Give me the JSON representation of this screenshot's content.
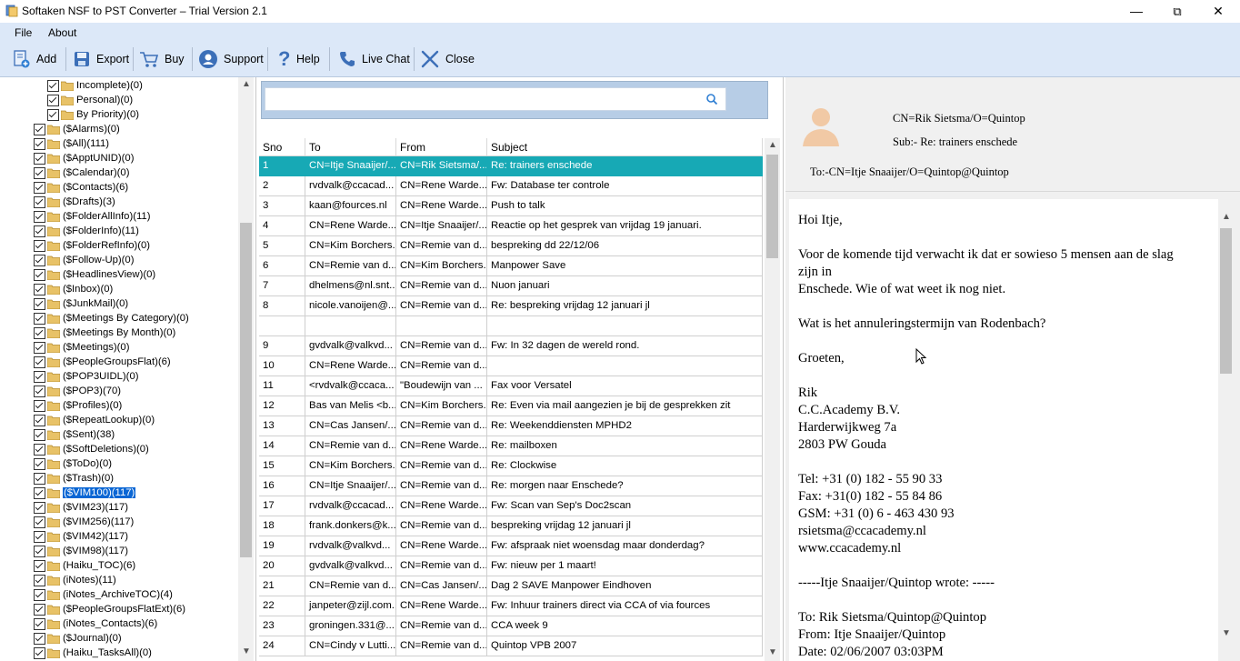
{
  "window": {
    "title": "Softaken NSF to PST Converter – Trial Version 2.1",
    "minimize": "—",
    "maximize": "⧉",
    "close": "✕"
  },
  "menu": [
    "File",
    "About"
  ],
  "toolbar": {
    "add": "Add",
    "export": "Export",
    "buy": "Buy",
    "support": "Support",
    "help": "Help",
    "live_chat": "Live Chat",
    "close": "Close"
  },
  "tree": {
    "items": [
      "Incomplete)(0)",
      "Personal)(0)",
      "By Priority)(0)",
      "($Alarms)(0)",
      "($All)(111)",
      "($ApptUNID)(0)",
      "($Calendar)(0)",
      "($Contacts)(6)",
      "($Drafts)(3)",
      "($FolderAllInfo)(11)",
      "($FolderInfo)(11)",
      "($FolderRefInfo)(0)",
      "($Follow-Up)(0)",
      "($HeadlinesView)(0)",
      "($Inbox)(0)",
      "($JunkMail)(0)",
      "($Meetings By Category)(0)",
      "($Meetings By Month)(0)",
      "($Meetings)(0)",
      "($PeopleGroupsFlat)(6)",
      "($POP3UIDL)(0)",
      "($POP3)(70)",
      "($Profiles)(0)",
      "($RepeatLookup)(0)",
      "($Sent)(38)",
      "($SoftDeletions)(0)",
      "($ToDo)(0)",
      "($Trash)(0)",
      "($VIM100)(117)",
      "($VIM23)(117)",
      "($VIM256)(117)",
      "($VIM42)(117)",
      "($VIM98)(117)",
      "(Haiku_TOC)(6)",
      "(iNotes)(11)",
      "(iNotes_ArchiveTOC)(4)",
      "($PeopleGroupsFlatExt)(6)",
      "(iNotes_Contacts)(6)",
      "($Journal)(0)",
      "(Haiku_TasksAll)(0)"
    ],
    "selected_index": 28
  },
  "search": {
    "placeholder": ""
  },
  "grid": {
    "columns": [
      "Sno",
      "To",
      "From",
      "Subject"
    ],
    "selected_row": 0,
    "rows": [
      [
        "1",
        "CN=Itje Snaaijer/...",
        "CN=Rik Sietsma/...",
        "Re: trainers enschede"
      ],
      [
        "2",
        "rvdvalk@ccacad...",
        "CN=Rene Warde...",
        "Fw: Database ter controle"
      ],
      [
        "3",
        "kaan@fources.nl",
        "CN=Rene Warde...",
        "Push to talk"
      ],
      [
        "4",
        "CN=Rene Warde...",
        "CN=Itje Snaaijer/...",
        "Reactie op het gesprek van vrijdag 19 januari."
      ],
      [
        "5",
        "CN=Kim Borchers...",
        "CN=Remie van d...",
        "bespreking dd 22/12/06"
      ],
      [
        "6",
        "CN=Remie van d...",
        "CN=Kim Borchers...",
        "Manpower Save"
      ],
      [
        "7",
        "dhelmens@nl.snt...",
        "CN=Remie van d...",
        "Nuon januari"
      ],
      [
        "8",
        "nicole.vanoijen@...",
        "CN=Remie van d...",
        "Re: bespreking vrijdag 12 januari jl"
      ],
      [
        "",
        "",
        "",
        ""
      ],
      [
        "9",
        "gvdvalk@valkvd...",
        "CN=Remie van d...",
        "Fw: In 32 dagen de wereld rond."
      ],
      [
        "10",
        "CN=Rene Warde...",
        "CN=Remie van d...",
        ""
      ],
      [
        "11",
        "<rvdvalk@ccaca...",
        "\"Boudewijn van ...",
        "Fax voor Versatel"
      ],
      [
        "12",
        "Bas van Melis <b...",
        "CN=Kim Borchers...",
        "Re: Even via mail aangezien je bij de gesprekken zit"
      ],
      [
        "13",
        "CN=Cas Jansen/...",
        "CN=Remie van d...",
        "Re: Weekenddiensten MPHD2"
      ],
      [
        "14",
        "CN=Remie van d...",
        "CN=Rene Warde...",
        "Re: mailboxen"
      ],
      [
        "15",
        "CN=Kim Borchers...",
        "CN=Remie van d...",
        "Re: Clockwise"
      ],
      [
        "16",
        "CN=Itje Snaaijer/...",
        "CN=Remie van d...",
        "Re: morgen naar Enschede?"
      ],
      [
        "17",
        "rvdvalk@ccacad...",
        "CN=Rene Warde...",
        "Fw: Scan van Sep's Doc2scan"
      ],
      [
        "18",
        "frank.donkers@k...",
        "CN=Remie van d...",
        "bespreking vrijdag 12 januari jl"
      ],
      [
        "19",
        "rvdvalk@valkvd...",
        "CN=Rene Warde...",
        "Fw: afspraak niet woensdag maar donderdag?"
      ],
      [
        "20",
        "gvdvalk@valkvd...",
        "CN=Remie van d...",
        "Fw: nieuw per 1 maart!"
      ],
      [
        "21",
        "CN=Remie van d...",
        "CN=Cas Jansen/...",
        "Dag 2 SAVE Manpower Eindhoven"
      ],
      [
        "22",
        "janpeter@zijl.com...",
        "CN=Rene Warde...",
        "Fw: Inhuur trainers direct via CCA of via fources"
      ],
      [
        "23",
        "groningen.331@...",
        "CN=Remie van d...",
        "CCA week 9"
      ],
      [
        "24",
        "CN=Cindy v Lutti...",
        "CN=Remie van d...",
        "Quintop VPB 2007"
      ]
    ]
  },
  "preview": {
    "from": "CN=Rik Sietsma/O=Quintop",
    "subject": "Sub:- Re: trainers enschede",
    "to": "To:-CN=Itje Snaaijer/O=Quintop@Quintop",
    "body_lines": [
      "Hoi Itje,",
      "",
      "Voor de komende tijd verwacht ik dat er sowieso 5 mensen aan de slag",
      "zijn in",
      "Enschede. Wie of wat weet ik nog niet.",
      "",
      "Wat is het annuleringstermijn van Rodenbach?",
      "",
      "Groeten,",
      "",
      "Rik",
      "C.C.Academy B.V.",
      "Harderwijkweg 7a",
      "2803 PW Gouda",
      "",
      "Tel: +31 (0) 182 - 55 90 33",
      "Fax: +31(0) 182 - 55 84 86",
      "GSM: +31 (0) 6 - 463 430 93",
      "rsietsma@ccacademy.nl",
      "www.ccacademy.nl",
      "",
      "-----Itje Snaaijer/Quintop wrote: -----",
      "",
      "To: Rik Sietsma/Quintop@Quintop",
      "From: Itje Snaaijer/Quintop",
      "Date: 02/06/2007 03:03PM"
    ]
  },
  "colors": {
    "menu_bg": "#dce8f8",
    "selected_row": "#17a9b5",
    "tree_selection": "#0a66d4"
  },
  "icons": [
    "app-icon",
    "add-icon",
    "export-icon",
    "cart-icon",
    "support-icon",
    "help-icon",
    "phone-icon",
    "close-x-icon",
    "search-icon",
    "avatar-icon",
    "checkbox-icon",
    "folder-icon"
  ]
}
